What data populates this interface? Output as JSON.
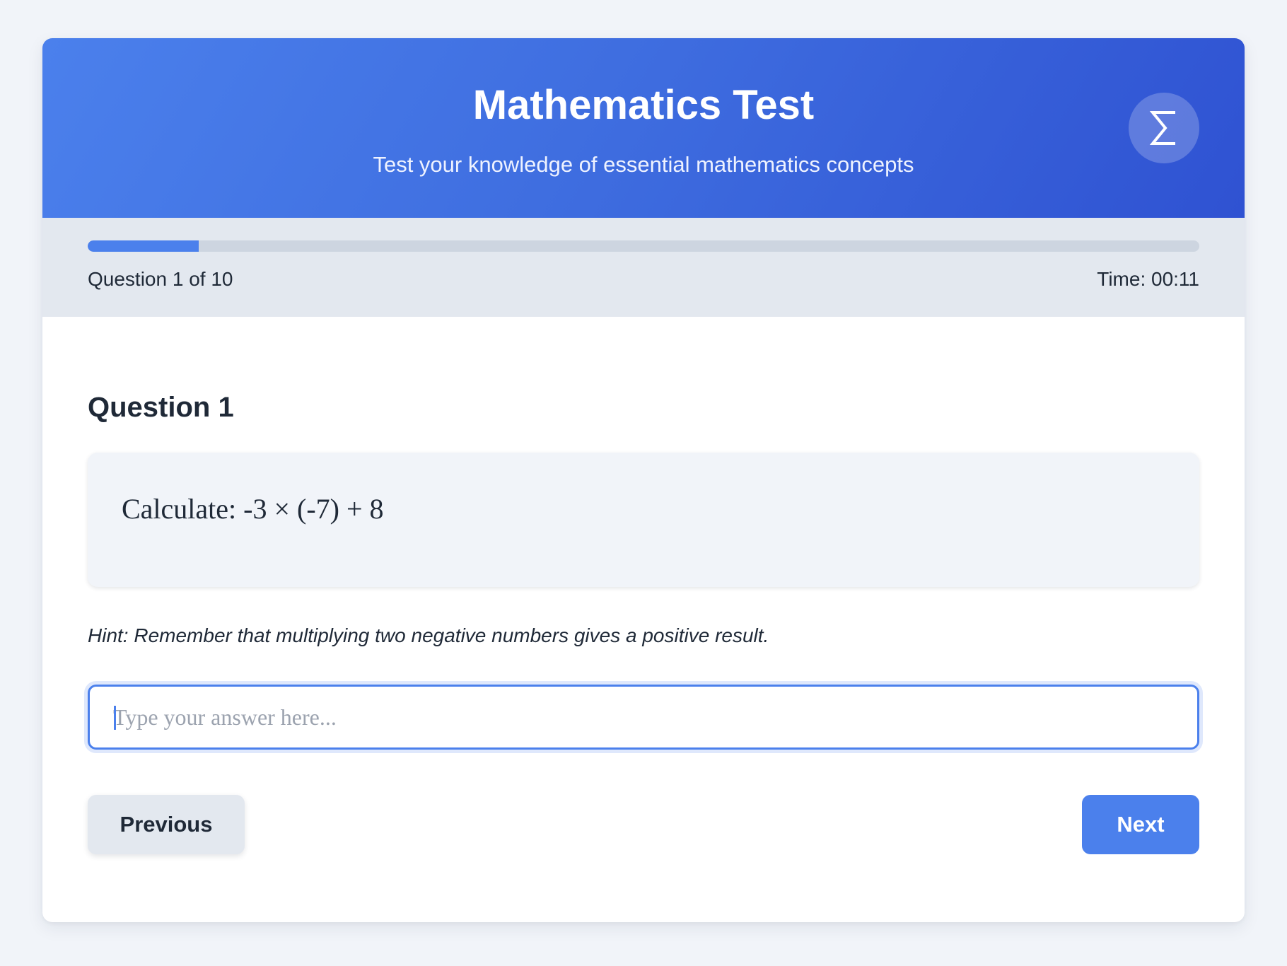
{
  "header": {
    "title": "Mathematics Test",
    "subtitle": "Test your knowledge of essential mathematics concepts",
    "logo_icon": "sigma-icon",
    "gradient_start": "#4b80ec",
    "gradient_end": "#2f52d2"
  },
  "progress": {
    "fraction": 0.1,
    "question_counter": "Question 1 of 10",
    "timer": "Time: 00:11",
    "fill_color": "#4b80ec",
    "track_color": "#cdd5e0"
  },
  "question": {
    "heading": "Question 1",
    "problem": "Calculate: -3 × (-7) + 8",
    "hint": "Hint: Remember that multiplying two negative numbers gives a positive result."
  },
  "answer": {
    "value": "",
    "placeholder": "Type your answer here..."
  },
  "buttons": {
    "previous_label": "Previous",
    "next_label": "Next",
    "accent_color": "#4b80ec"
  }
}
